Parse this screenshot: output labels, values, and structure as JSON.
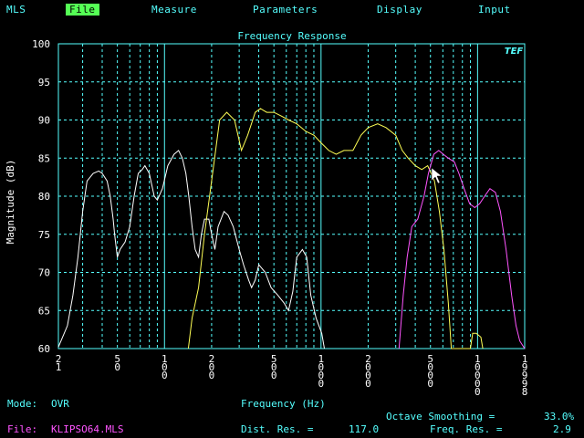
{
  "app": {
    "name": "MLS"
  },
  "menu": [
    {
      "label": "File",
      "active": true
    },
    {
      "label": "Measure",
      "active": false
    },
    {
      "label": "Parameters",
      "active": false
    },
    {
      "label": "Display",
      "active": false
    },
    {
      "label": "Input",
      "active": false
    }
  ],
  "chart_data": {
    "type": "line",
    "title": "Frequency Response",
    "xlabel": "Frequency (Hz)",
    "ylabel": "Magnitude (dB)",
    "x_scale": "log",
    "xlim": [
      21,
      19998
    ],
    "ylim": [
      60,
      100
    ],
    "grid": true,
    "logo": "TEF",
    "y_ticks": [
      60,
      65,
      70,
      75,
      80,
      85,
      90,
      95,
      100
    ],
    "x_tick_labels": [
      {
        "value": 21,
        "text": "21"
      },
      {
        "value": 50,
        "text": "50"
      },
      {
        "value": 100,
        "text": "100"
      },
      {
        "value": 200,
        "text": "200"
      },
      {
        "value": 500,
        "text": "500"
      },
      {
        "value": 1000,
        "text": "1000"
      },
      {
        "value": 2000,
        "text": "2000"
      },
      {
        "value": 5000,
        "text": "5000"
      },
      {
        "value": 10000,
        "text": "10000"
      },
      {
        "value": 19998,
        "text": "19998"
      }
    ],
    "series": [
      {
        "color": "#ffffff",
        "points": [
          [
            21,
            60.2
          ],
          [
            24,
            63
          ],
          [
            26,
            67
          ],
          [
            28,
            72
          ],
          [
            30,
            78
          ],
          [
            32,
            82
          ],
          [
            35,
            83
          ],
          [
            38,
            83.3
          ],
          [
            40,
            83
          ],
          [
            43,
            82
          ],
          [
            45,
            80
          ],
          [
            47,
            77
          ],
          [
            48,
            75
          ],
          [
            50,
            72
          ],
          [
            52,
            73
          ],
          [
            56,
            74
          ],
          [
            60,
            76
          ],
          [
            64,
            80
          ],
          [
            68,
            83
          ],
          [
            72,
            83.5
          ],
          [
            75,
            84
          ],
          [
            80,
            83
          ],
          [
            86,
            80
          ],
          [
            90,
            79.5
          ],
          [
            97,
            81
          ],
          [
            105,
            84
          ],
          [
            115,
            85.5
          ],
          [
            123,
            86
          ],
          [
            130,
            85
          ],
          [
            137,
            83
          ],
          [
            143,
            80
          ],
          [
            150,
            76
          ],
          [
            157,
            73
          ],
          [
            165,
            72
          ],
          [
            172,
            75
          ],
          [
            180,
            77
          ],
          [
            192,
            77
          ],
          [
            200,
            75
          ],
          [
            210,
            73
          ],
          [
            220,
            76
          ],
          [
            240,
            78
          ],
          [
            255,
            77.5
          ],
          [
            275,
            76
          ],
          [
            300,
            73
          ],
          [
            320,
            71
          ],
          [
            345,
            69
          ],
          [
            360,
            68
          ],
          [
            380,
            69
          ],
          [
            400,
            71
          ],
          [
            440,
            70
          ],
          [
            480,
            68
          ],
          [
            530,
            67
          ],
          [
            580,
            66
          ],
          [
            620,
            65
          ],
          [
            660,
            67.5
          ],
          [
            700,
            72
          ],
          [
            760,
            73
          ],
          [
            810,
            72
          ],
          [
            860,
            67
          ],
          [
            930,
            64
          ],
          [
            1010,
            62
          ],
          [
            1050,
            60
          ]
        ]
      },
      {
        "color": "#ffff55",
        "points": [
          [
            142,
            60
          ],
          [
            150,
            64
          ],
          [
            165,
            68
          ],
          [
            180,
            75
          ],
          [
            200,
            82
          ],
          [
            225,
            90
          ],
          [
            250,
            91
          ],
          [
            280,
            90
          ],
          [
            310,
            86
          ],
          [
            340,
            88
          ],
          [
            380,
            91
          ],
          [
            410,
            91.5
          ],
          [
            450,
            91
          ],
          [
            500,
            91
          ],
          [
            560,
            90.5
          ],
          [
            620,
            90
          ],
          [
            700,
            89.5
          ],
          [
            800,
            88.5
          ],
          [
            900,
            88
          ],
          [
            1000,
            87
          ],
          [
            1120,
            86
          ],
          [
            1250,
            85.5
          ],
          [
            1400,
            86
          ],
          [
            1600,
            86
          ],
          [
            1800,
            88
          ],
          [
            2000,
            89
          ],
          [
            2300,
            89.5
          ],
          [
            2600,
            89
          ],
          [
            3000,
            88
          ],
          [
            3300,
            86
          ],
          [
            3600,
            85
          ],
          [
            4000,
            84
          ],
          [
            4400,
            83.5
          ],
          [
            4800,
            84
          ],
          [
            5300,
            82
          ],
          [
            5700,
            78
          ],
          [
            6100,
            73
          ],
          [
            6500,
            66
          ],
          [
            6800,
            60
          ],
          [
            9000,
            60
          ],
          [
            9300,
            62
          ],
          [
            9800,
            62
          ],
          [
            10500,
            61.5
          ],
          [
            10800,
            60
          ]
        ]
      },
      {
        "color": "#ff55ff",
        "points": [
          [
            3150,
            60
          ],
          [
            3350,
            67
          ],
          [
            3550,
            72
          ],
          [
            3800,
            76
          ],
          [
            4150,
            77
          ],
          [
            4550,
            80
          ],
          [
            4850,
            83
          ],
          [
            5250,
            85.5
          ],
          [
            5650,
            86
          ],
          [
            6050,
            85.5
          ],
          [
            6500,
            85
          ],
          [
            7100,
            84.5
          ],
          [
            7600,
            83
          ],
          [
            8200,
            81
          ],
          [
            8900,
            79
          ],
          [
            9600,
            78.5
          ],
          [
            10300,
            79
          ],
          [
            11100,
            80
          ],
          [
            12000,
            81
          ],
          [
            13000,
            80.5
          ],
          [
            14000,
            78
          ],
          [
            15200,
            73
          ],
          [
            16500,
            67
          ],
          [
            17600,
            63
          ],
          [
            18600,
            61
          ],
          [
            19998,
            60
          ]
        ]
      }
    ]
  },
  "status": {
    "mode_label": "Mode:",
    "mode_value": "OVR",
    "file_label": "File:",
    "file_value": "KLIPSO64.MLS",
    "octave_label": "Octave Smoothing =",
    "octave_value": "33.0%",
    "dist_label": "Dist. Res. =",
    "dist_value": "117.0",
    "freq_label": "Freq. Res. =",
    "freq_value": "2.9"
  },
  "colors": {
    "grid_solid": "#55ffff",
    "grid_dashed": "#55ffff",
    "axis_text": "#ffffff",
    "title_text": "#55ffff",
    "label_text": "#55ffff",
    "file_text": "#ff55ff"
  }
}
